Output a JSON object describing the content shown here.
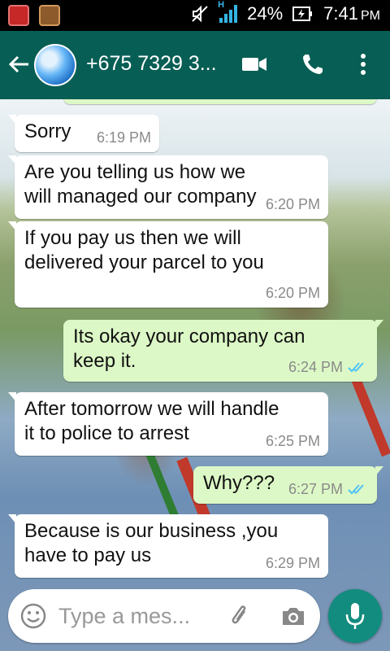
{
  "status_bar": {
    "battery": "24%",
    "time": "7:41",
    "ampm": "PM",
    "network": "H"
  },
  "toolbar": {
    "contact": "+675 7329 3...",
    "color": "#075e54"
  },
  "messages": [
    {
      "text": "Sorry",
      "time": "6:19 PM",
      "direction": "incoming"
    },
    {
      "text": "Are you telling us how we will managed our company",
      "time": "6:20 PM",
      "direction": "incoming"
    },
    {
      "text": "If you pay us then we will delivered your parcel to you",
      "time": "6:20 PM",
      "direction": "incoming"
    },
    {
      "text": "Its okay your company can keep it.",
      "time": "6:24 PM",
      "direction": "outgoing",
      "status": "read"
    },
    {
      "text": "After tomorrow we will handle it to police to arrest",
      "time": "6:25 PM",
      "direction": "incoming"
    },
    {
      "text": "Why???",
      "time": "6:27 PM",
      "direction": "outgoing",
      "status": "read"
    },
    {
      "text": "Because is our business ,you have to pay us",
      "time": "6:29 PM",
      "direction": "incoming"
    }
  ],
  "composer": {
    "placeholder": "Type a mes..."
  },
  "icons": [
    "back-arrow-icon",
    "video-call-icon",
    "voice-call-icon",
    "more-options-icon",
    "emoji-icon",
    "attach-icon",
    "camera-icon",
    "mic-icon",
    "read-receipt-icon"
  ],
  "colors": {
    "outgoing_bubble": "#dcf8c6",
    "incoming_bubble": "#ffffff",
    "read_ticks": "#4fc3f7",
    "mic_button": "#128c7e"
  }
}
